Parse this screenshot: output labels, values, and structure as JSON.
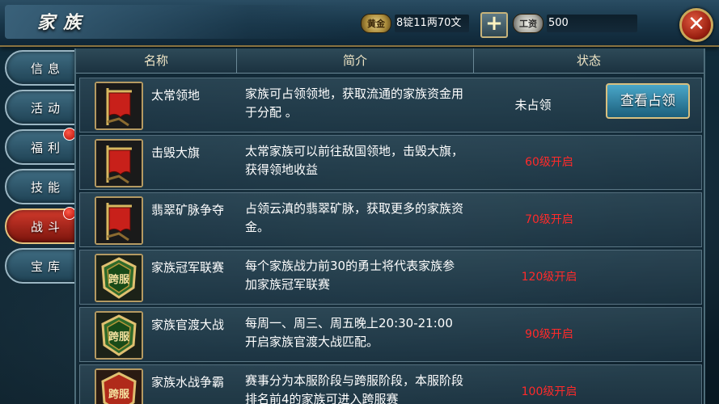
{
  "header": {
    "title": "家族",
    "gold_label": "黄金",
    "gold_value": "8锭11两70文",
    "plus_label": "+",
    "wage_label": "工资",
    "wage_value": "500",
    "close_label": "✕"
  },
  "sidebar": {
    "items": [
      {
        "label": "信息",
        "active": false,
        "badge": false
      },
      {
        "label": "活动",
        "active": false,
        "badge": false
      },
      {
        "label": "福利",
        "active": false,
        "badge": true
      },
      {
        "label": "技能",
        "active": false,
        "badge": false
      },
      {
        "label": "战斗",
        "active": true,
        "badge": true
      },
      {
        "label": "宝库",
        "active": false,
        "badge": false
      }
    ]
  },
  "table": {
    "columns": [
      "名称",
      "简介",
      "状态"
    ],
    "rows": [
      {
        "name": "太常领地",
        "desc": "家族可占领领地，获取流通的家族资金用于分配 。",
        "status": "未占领",
        "button": "查看占领",
        "icon": "red-banner-icon"
      },
      {
        "name": "击毁大旗",
        "desc": "太常家族可以前往敌国领地，击毁大旗，获得领地收益",
        "status": "60级开启",
        "icon": "red-banner-icon"
      },
      {
        "name": "翡翠矿脉争夺",
        "desc": "占领云滇的翡翠矿脉，获取更多的家族资金。",
        "status": "70级开启",
        "icon": "red-banner-icon"
      },
      {
        "name": "家族冠军联赛",
        "desc": "每个家族战力前30的勇士将代表家族参加家族冠军联赛",
        "status": "120级开启",
        "icon": "cross-server-emblem-icon",
        "emblem_text": "跨服"
      },
      {
        "name": "家族官渡大战",
        "desc": "每周一、周三、周五晚上20:30-21:00开启家族官渡大战匹配。",
        "status": "90级开启",
        "icon": "cross-server-emblem-icon",
        "emblem_text": "跨服"
      },
      {
        "name": "家族水战争霸",
        "desc": "赛事分为本服阶段与跨服阶段，本服阶段排名前4的家族可进入跨服赛",
        "status": "100级开启",
        "icon": "cross-server-emblem-icon",
        "emblem_text": "跨服"
      }
    ]
  },
  "colors": {
    "locked_status": "#ff2a2a",
    "active_tab": "#d23a2c",
    "gold_border": "#b59a62"
  }
}
